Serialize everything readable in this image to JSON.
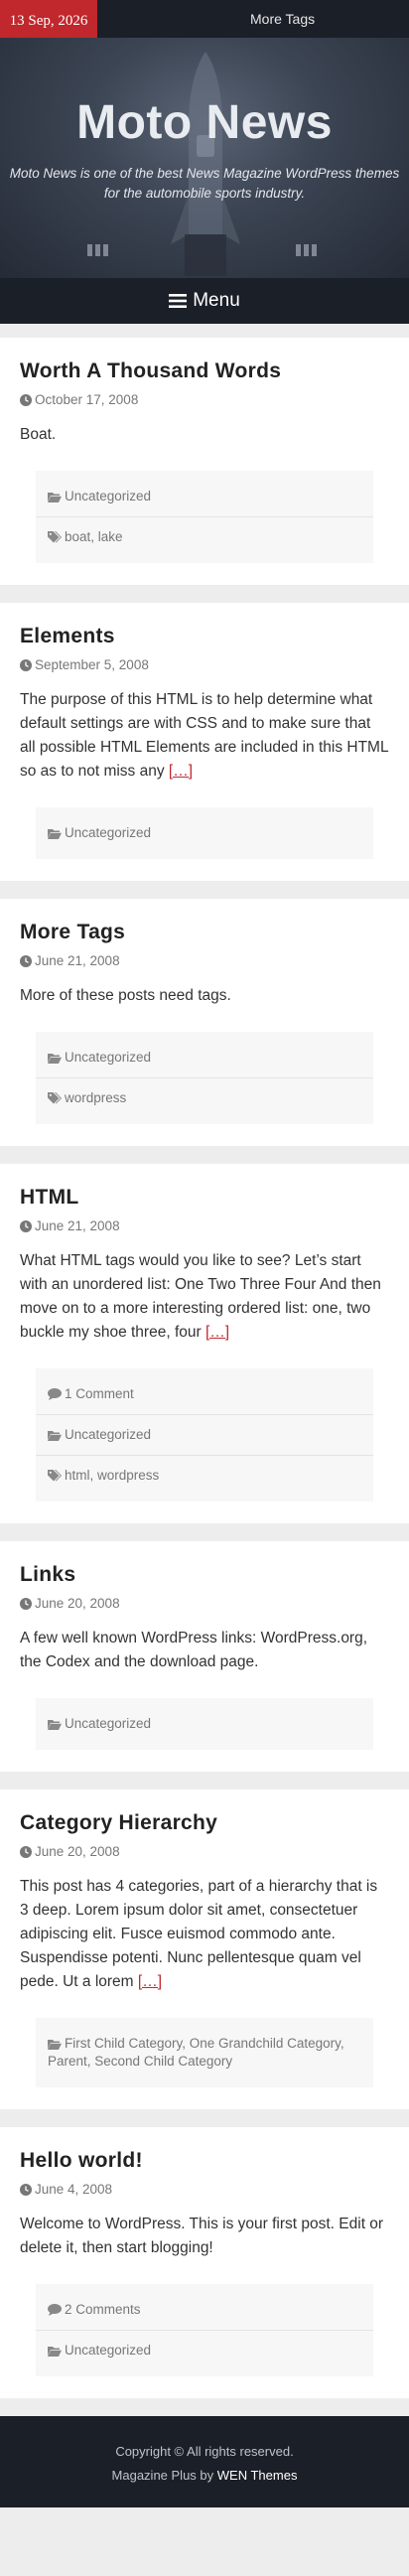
{
  "topbar": {
    "date": "13 Sep, 2026",
    "link": "More Tags"
  },
  "site": {
    "title": "Moto News",
    "description": "Moto News is one of the best News Magazine WordPress themes for the automobile sports industry."
  },
  "menu": {
    "label": "Menu"
  },
  "posts": [
    {
      "title": "Worth A Thousand Words",
      "date": "October 17, 2008",
      "excerpt": "Boat.",
      "more": "",
      "comments": "",
      "categories": "Uncategorized",
      "tags": "boat, lake"
    },
    {
      "title": "Elements",
      "date": "September 5, 2008",
      "excerpt": "The purpose of this HTML is to help determine what default settings are with CSS and to make sure that all possible HTML Elements are included in this HTML so as to not miss any ",
      "more": "[…]",
      "comments": "",
      "categories": "Uncategorized",
      "tags": ""
    },
    {
      "title": "More Tags",
      "date": "June 21, 2008",
      "excerpt": "More of these posts need tags.",
      "more": "",
      "comments": "",
      "categories": "Uncategorized",
      "tags": "wordpress"
    },
    {
      "title": "HTML",
      "date": "June 21, 2008",
      "excerpt": "What HTML tags would you like to see? Let’s start with an unordered list: One Two Three Four And then move on to a more interesting ordered list: one, two buckle my shoe three, four ",
      "more": "[…]",
      "comments": "1 Comment",
      "categories": "Uncategorized",
      "tags": "html, wordpress"
    },
    {
      "title": "Links",
      "date": "June 20, 2008",
      "excerpt": "A few well known WordPress links: WordPress.org, the Codex and the download page.",
      "more": "",
      "comments": "",
      "categories": "Uncategorized",
      "tags": ""
    },
    {
      "title": "Category Hierarchy",
      "date": "June 20, 2008",
      "excerpt": "This post has 4 categories, part of a hierarchy that is 3 deep. Lorem ipsum dolor sit amet, consectetuer adipiscing elit. Fusce euismod commodo ante. Suspendisse potenti. Nunc pellentesque quam vel pede. Ut a lorem ",
      "more": "[…]",
      "comments": "",
      "categories": "First Child Category,  One Grandchild Category,  Parent,  Second Child Category",
      "tags": ""
    },
    {
      "title": "Hello world!",
      "date": "June 4, 2008",
      "excerpt": "Welcome to WordPress. This is your first post. Edit or delete it, then start blogging!",
      "more": "",
      "comments": "2 Comments",
      "categories": "Uncategorized",
      "tags": ""
    }
  ],
  "footer": {
    "copyright": "Copyright © All rights reserved.",
    "theme": "Magazine Plus",
    "by": " by ",
    "author": "WEN Themes"
  },
  "colors": {
    "accent": "#c0282d",
    "dark": "#1b1f27"
  },
  "icons": {
    "date": "clock-icon",
    "comments": "comment-icon",
    "categories": "folder-open-icon",
    "tags": "tags-icon",
    "menu": "bars-icon"
  }
}
